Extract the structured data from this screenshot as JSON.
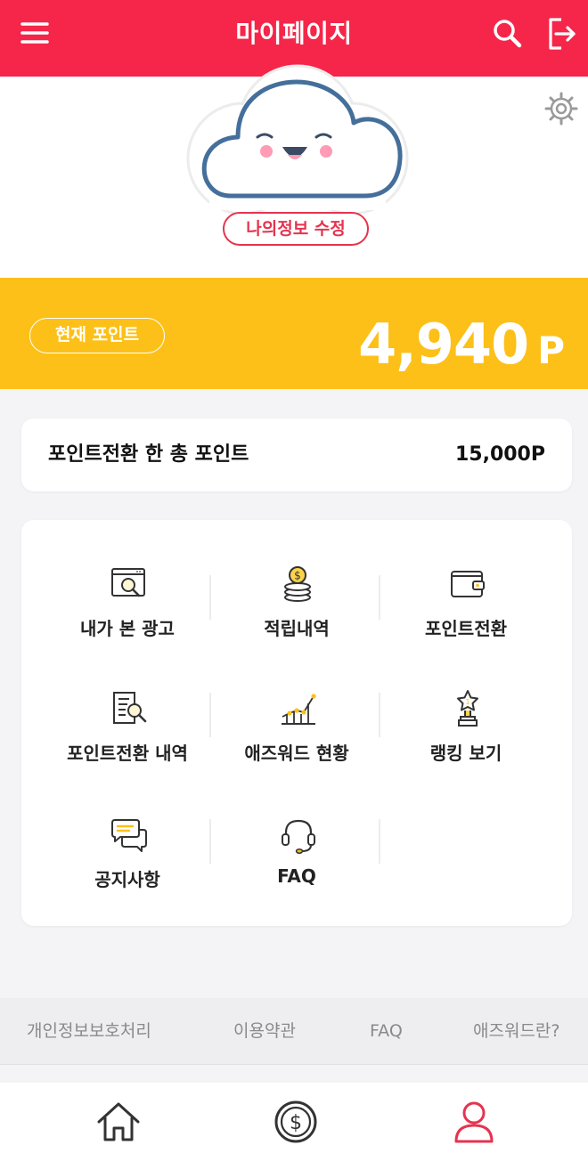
{
  "header": {
    "title": "마이페이지",
    "menu_icon": "hamburger-menu-icon",
    "search_icon": "search-icon",
    "logout_icon": "logout-icon",
    "bg_color": "#f5264a"
  },
  "profile": {
    "avatar_icon": "smiling-cloud-avatar",
    "settings_icon": "gear-icon",
    "edit_button": "나의정보 수정"
  },
  "points": {
    "label": "현재 포인트",
    "value": "4,940",
    "unit": "P",
    "bg_color": "#fcc018"
  },
  "total_converted": {
    "label": "포인트전환 한 총 포인트",
    "value": "15,000P"
  },
  "menu": [
    {
      "label": "내가 본 광고",
      "icon": "browser-search-icon"
    },
    {
      "label": "적립내역",
      "icon": "coin-stack-icon"
    },
    {
      "label": "포인트전환",
      "icon": "wallet-icon"
    },
    {
      "label": "포인트전환 내역",
      "icon": "document-search-icon"
    },
    {
      "label": "애즈워드 현황",
      "icon": "line-chart-icon"
    },
    {
      "label": "랭킹 보기",
      "icon": "trophy-icon"
    },
    {
      "label": "공지사항",
      "icon": "chat-bubbles-icon"
    },
    {
      "label": "FAQ",
      "icon": "headset-icon"
    }
  ],
  "footer_links": [
    "개인정보보호처리",
    "이용약관",
    "FAQ",
    "애즈워드란?"
  ],
  "bottom_nav": [
    {
      "icon": "home-icon",
      "active": false
    },
    {
      "icon": "dollar-coin-icon",
      "active": false
    },
    {
      "icon": "user-icon",
      "active": true
    }
  ]
}
